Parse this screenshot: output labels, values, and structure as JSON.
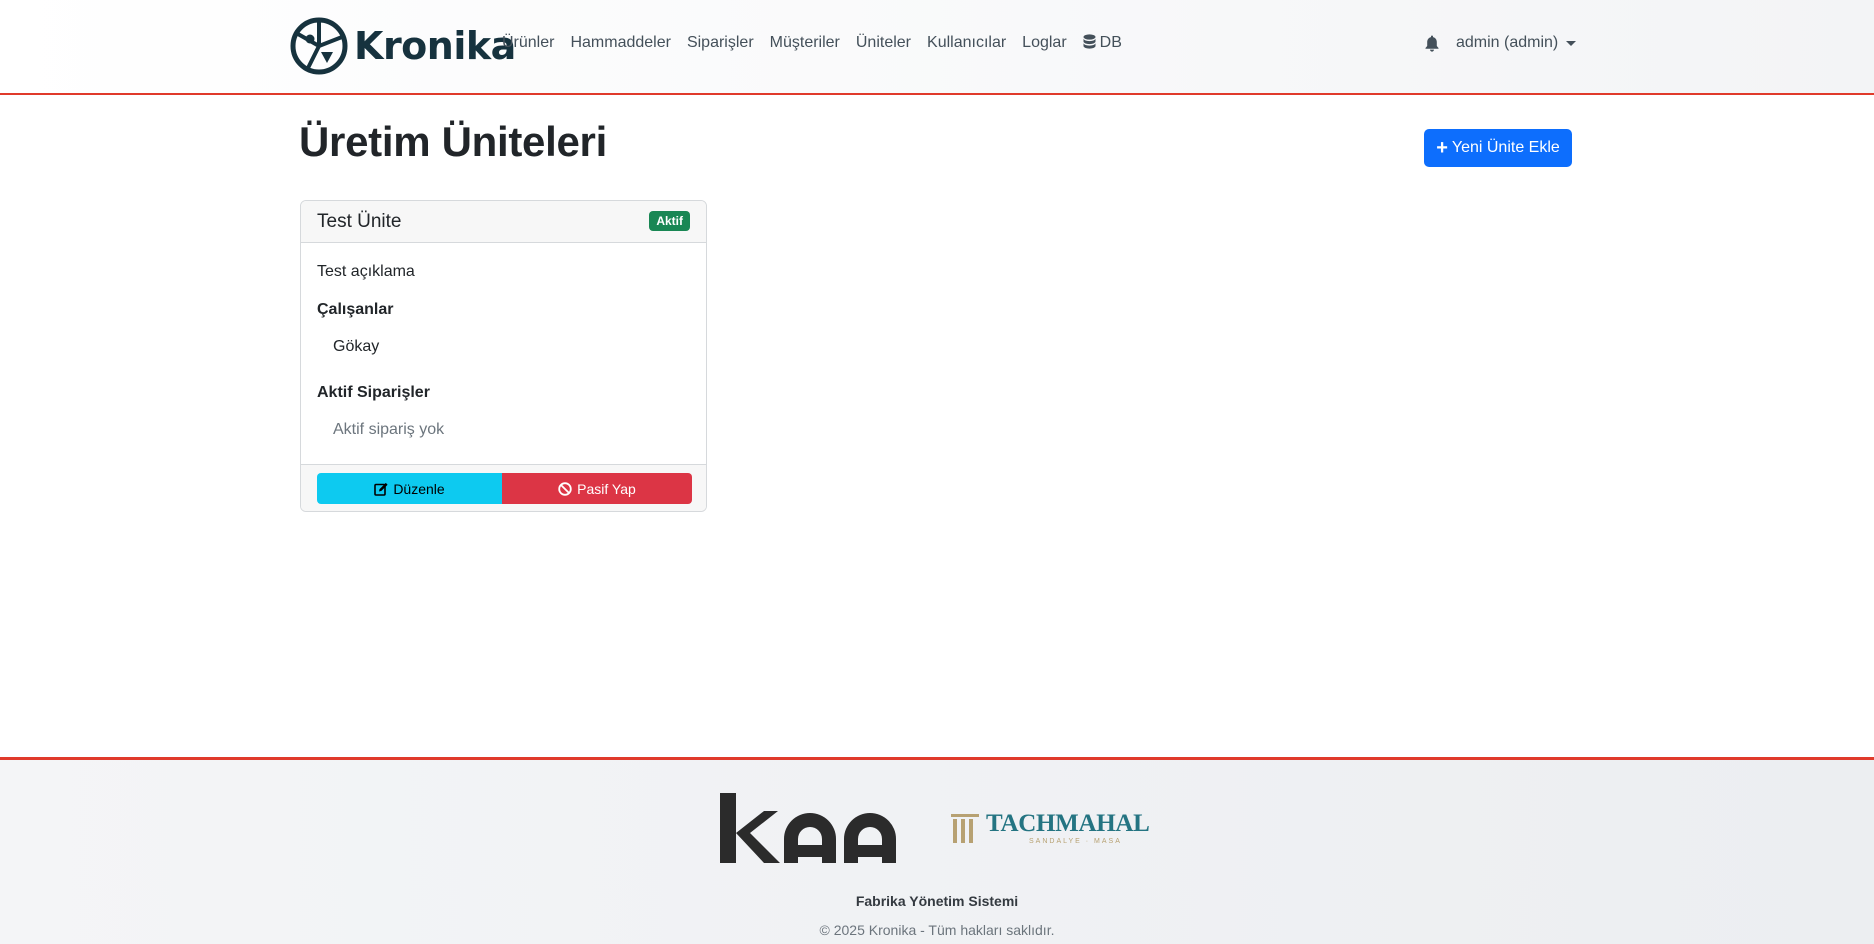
{
  "brand": {
    "name": "Kronika",
    "colors": {
      "primary": "#16323e",
      "accent_line": "#e03a2b"
    }
  },
  "nav": {
    "links": [
      "Ürünler",
      "Hammaddeler",
      "Siparişler",
      "Müşteriler",
      "Üniteler",
      "Kullanıcılar",
      "Loglar"
    ],
    "db_label": "DB",
    "user_label": "admin (admin)"
  },
  "page": {
    "title": "Üretim Üniteleri",
    "new_button_label": "Yeni Ünite Ekle"
  },
  "unit_card": {
    "name": "Test Ünite",
    "status_badge": "Aktif",
    "description": "Test açıklama",
    "employees_title": "Çalışanlar",
    "employees": [
      "Gökay"
    ],
    "orders_title": "Aktif Siparişler",
    "orders_empty": "Aktif sipariş yok",
    "edit_label": "Düzenle",
    "deactivate_label": "Pasif Yap"
  },
  "footer": {
    "partner_logos": [
      "kaa",
      "TACHMAHAL"
    ],
    "tachmahal_subtitle": "SANDALYE · MASA",
    "system_name": "Fabrika Yönetim Sistemi",
    "copyright": "© 2025 Kronika - Tüm hakları saklıdır."
  },
  "colors": {
    "primary_button": "#0d6efd",
    "info_button": "#0dcaf0",
    "danger_button": "#dc3545",
    "success_badge": "#198754"
  }
}
